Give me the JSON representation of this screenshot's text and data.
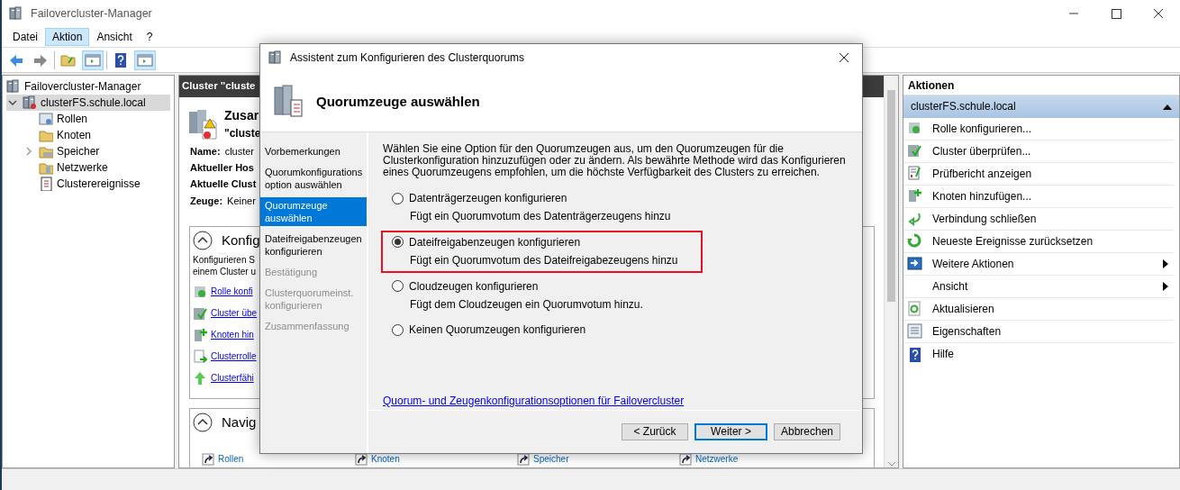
{
  "window": {
    "title": "Failovercluster-Manager"
  },
  "menu": [
    {
      "label": "Datei",
      "selected": false
    },
    {
      "label": "Aktion",
      "selected": true
    },
    {
      "label": "Ansicht",
      "selected": false
    },
    {
      "label": "?",
      "selected": false
    }
  ],
  "toolbar": [
    {
      "kind": "back",
      "selected": false
    },
    {
      "kind": "forward",
      "selected": false
    },
    {
      "kind": "up",
      "selected": false
    },
    {
      "kind": "pane",
      "selected": true
    },
    {
      "kind": "help",
      "selected": false
    },
    {
      "kind": "pane",
      "selected": true
    }
  ],
  "tree": {
    "label": "Failovercluster-Manager",
    "children": [
      {
        "label": "clusterFS.schule.local",
        "selected": true,
        "expanded": true,
        "children": [
          {
            "label": "Rollen",
            "expandable": false
          },
          {
            "label": "Knoten",
            "expandable": false
          },
          {
            "label": "Speicher",
            "expandable": true
          },
          {
            "label": "Netzwerke",
            "expandable": false
          },
          {
            "label": "Clusterereignisse",
            "expandable": false
          }
        ]
      }
    ]
  },
  "center": {
    "header": "Cluster \"cluste",
    "summary_title": "Zusar",
    "summary_subtitle": "\"cluste",
    "properties": [
      {
        "label": "Name:",
        "value": "cluster"
      },
      {
        "label": "Aktueller Hos"
      },
      {
        "label": "Aktuelle Clust"
      },
      {
        "label": "Zeuge:",
        "value": "Keiner"
      }
    ],
    "configure": {
      "title": "Konfig",
      "text": [
        "Konfigurieren S",
        "einem Cluster u"
      ],
      "links": [
        "Rolle konfi",
        "Cluster übe",
        "Knoten hin",
        "Clusterrolle",
        "Clusterfähi"
      ]
    },
    "navigate": {
      "title": "Navig",
      "links": [
        "Rollen",
        "Knoten",
        "Speicher",
        "Netzwerke"
      ]
    }
  },
  "actions": {
    "title": "Aktionen",
    "group": "clusterFS.schule.local",
    "items": [
      {
        "label": "Rolle konfigurieren...",
        "submenu": false
      },
      {
        "label": "Cluster überprüfen...",
        "submenu": false
      },
      {
        "label": "Prüfbericht anzeigen",
        "submenu": false
      },
      {
        "label": "Knoten hinzufügen...",
        "submenu": false
      },
      {
        "label": "Verbindung schließen",
        "submenu": false
      },
      {
        "label": "Neueste Ereignisse zurücksetzen",
        "submenu": false
      },
      {
        "label": "Weitere Aktionen",
        "submenu": true
      },
      {
        "label": "Ansicht",
        "submenu": true
      },
      {
        "label": "Aktualisieren",
        "submenu": false
      },
      {
        "label": "Eigenschaften",
        "submenu": false
      },
      {
        "label": "Hilfe",
        "submenu": false
      }
    ]
  },
  "dialog": {
    "title": "Assistent zum Konfigurieren des Clusterquorums",
    "heading": "Quorumzeuge auswählen",
    "steps": [
      {
        "label": "Vorbemerkungen",
        "selected": false,
        "disabled": false
      },
      {
        "label": "Quorumkonfigurations option auswählen",
        "selected": false,
        "disabled": false
      },
      {
        "label": "Quorumzeuge auswählen",
        "selected": true,
        "disabled": false
      },
      {
        "label": "Dateifreigabenzeugen konfigurieren",
        "selected": false,
        "disabled": false
      },
      {
        "label": "Bestätigung",
        "selected": false,
        "disabled": true
      },
      {
        "label": "Clusterquorumeinst. konfigurieren",
        "selected": false,
        "disabled": true
      },
      {
        "label": "Zusammenfassung",
        "selected": false,
        "disabled": true
      }
    ],
    "intro": "Wählen Sie eine Option für den Quorumzeugen aus, um den Quorumzeugen für die Clusterkonfiguration hinzuzufügen oder zu ändern. Als bewährte Methode wird das Konfigurieren eines Quorumzeugens empfohlen, um die höchste Verfügbarkeit des Clusters zu erreichen.",
    "options": [
      {
        "label": "Datenträgerzeugen konfigurieren",
        "description": "Fügt ein Quorumvotum des Datenträgerzeugens hinzu",
        "selected": false,
        "highlighted": false
      },
      {
        "label": "Dateifreigabenzeugen konfigurieren",
        "description": "Fügt ein Quorumvotum des Dateifreigabezeugens hinzu",
        "selected": true,
        "highlighted": true
      },
      {
        "label": "Cloudzeugen konfigurieren",
        "description": "Fügt dem Cloudzeugen ein Quorumvotum hinzu.",
        "selected": false,
        "highlighted": false
      },
      {
        "label": "Keinen Quorumzeugen konfigurieren",
        "selected": false,
        "highlighted": false
      }
    ],
    "link": "Quorum- und Zeugenkonfigurationsoptionen für Failovercluster",
    "buttons": [
      {
        "label": "< Zurück",
        "default": false
      },
      {
        "label": "Weiter >",
        "default": true
      },
      {
        "label": "Abbrechen",
        "default": false
      }
    ]
  }
}
